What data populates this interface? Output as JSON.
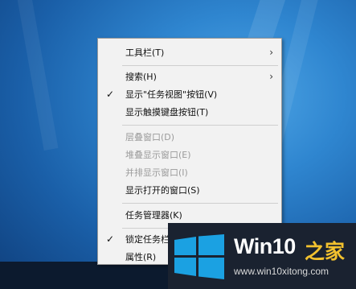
{
  "menu": {
    "items": [
      {
        "label": "工具栏(T)",
        "disabled": false,
        "checked": false,
        "submenu": true
      },
      {
        "label": "搜索(H)",
        "disabled": false,
        "checked": false,
        "submenu": true
      },
      {
        "label": "显示\"任务视图\"按钮(V)",
        "disabled": false,
        "checked": true,
        "submenu": false
      },
      {
        "label": "显示触摸键盘按钮(T)",
        "disabled": false,
        "checked": false,
        "submenu": false
      },
      {
        "label": "层叠窗口(D)",
        "disabled": true,
        "checked": false,
        "submenu": false
      },
      {
        "label": "堆叠显示窗口(E)",
        "disabled": true,
        "checked": false,
        "submenu": false
      },
      {
        "label": "并排显示窗口(I)",
        "disabled": true,
        "checked": false,
        "submenu": false
      },
      {
        "label": "显示打开的窗口(S)",
        "disabled": false,
        "checked": false,
        "submenu": false
      },
      {
        "label": "任务管理器(K)",
        "disabled": false,
        "checked": false,
        "submenu": false
      },
      {
        "label": "锁定任务栏(L)",
        "disabled": false,
        "checked": true,
        "submenu": false
      },
      {
        "label": "属性(R)",
        "disabled": false,
        "checked": false,
        "submenu": false
      }
    ],
    "check_glyph": "✓",
    "arrow_glyph": "›"
  },
  "watermark": {
    "win_text": "Win10",
    "zh_text": "之家",
    "url": "www.win10xitong.com",
    "logo_icon": "windows-logo-icon",
    "colors": {
      "logo": "#1ba1e2",
      "zh": "#f2c12e"
    }
  }
}
